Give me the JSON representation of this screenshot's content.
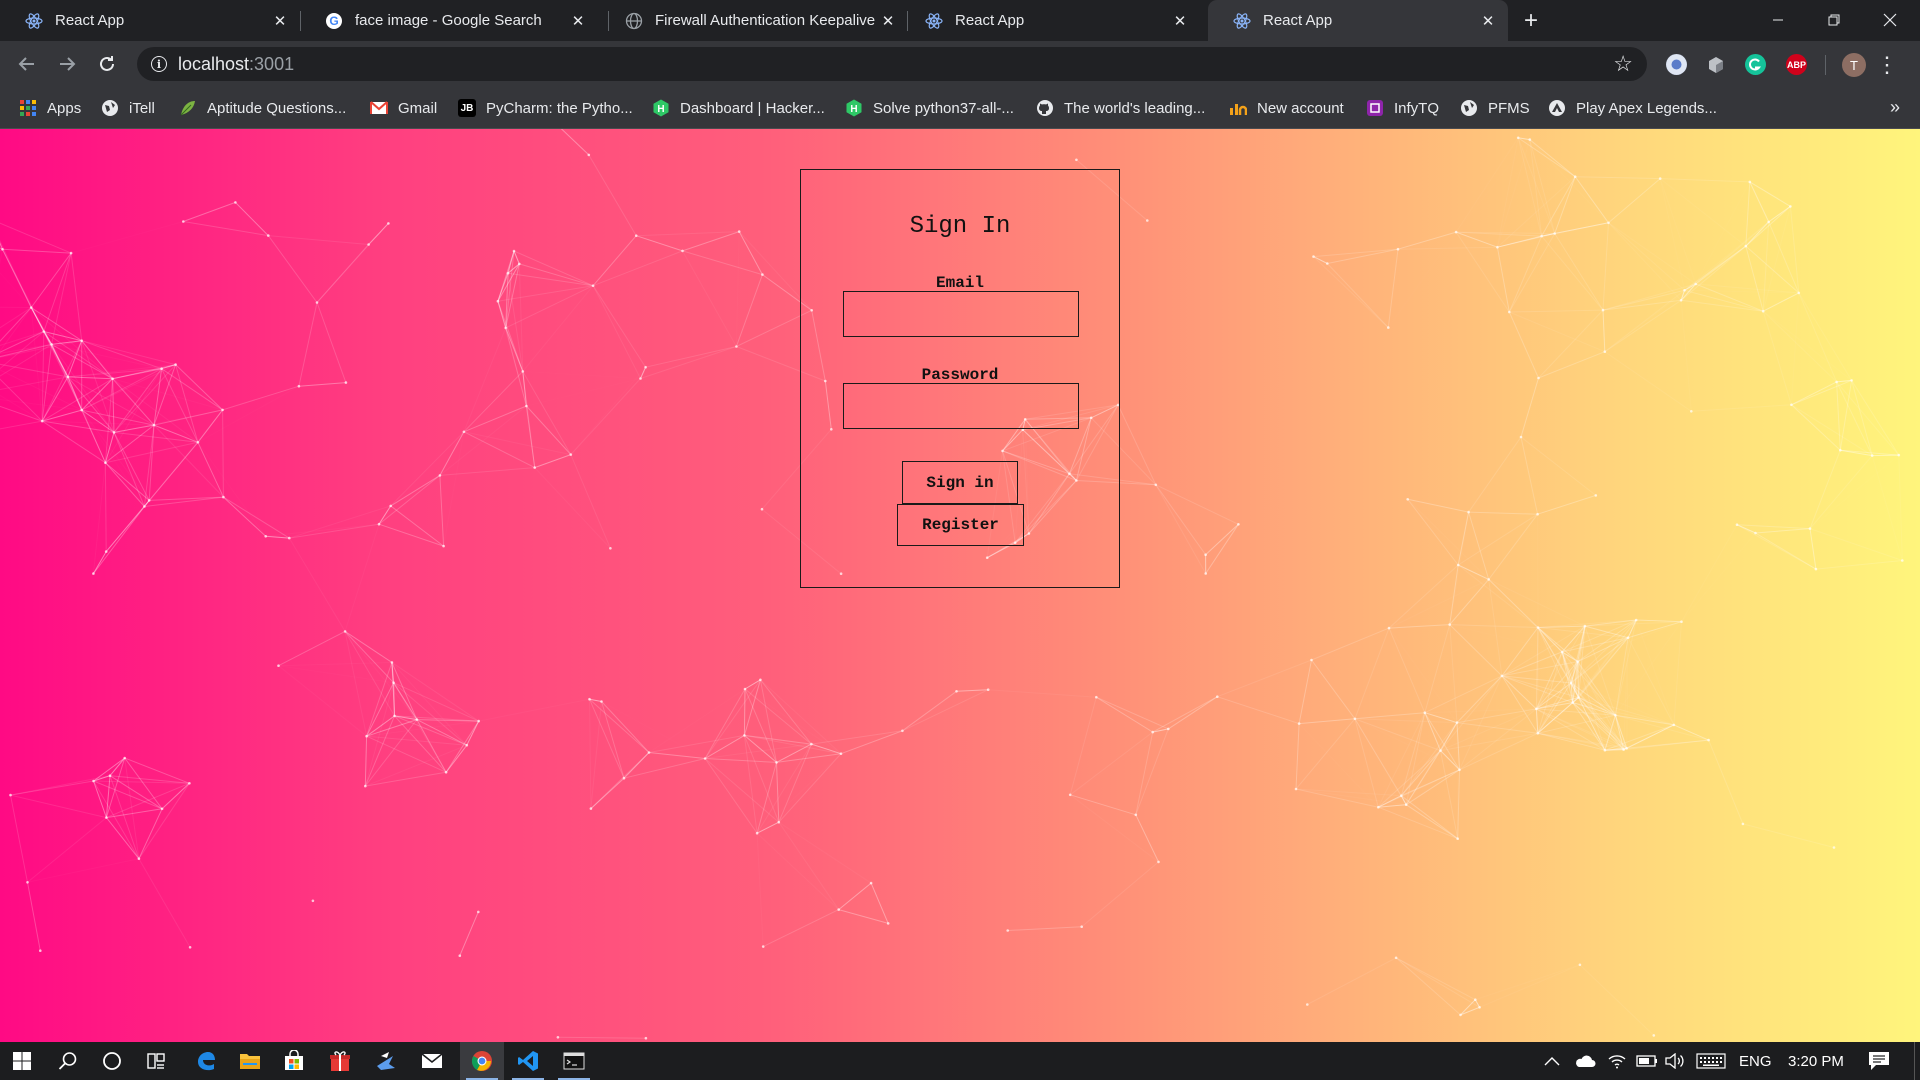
{
  "tabs": [
    {
      "title": "React App",
      "icon": "react-icon",
      "active": false
    },
    {
      "title": "face image - Google Search",
      "icon": "google-icon",
      "active": false
    },
    {
      "title": "Firewall Authentication Keepalive",
      "icon": "globe-icon",
      "active": false
    },
    {
      "title": "React App",
      "icon": "react-icon",
      "active": false
    },
    {
      "title": "React App",
      "icon": "react-icon",
      "active": true
    }
  ],
  "address_bar": {
    "host": "localhost",
    "port": ":3001"
  },
  "bookmarks": [
    {
      "label": "Apps",
      "icon": "apps-grid-icon"
    },
    {
      "label": "iTell",
      "icon": "globe-icon"
    },
    {
      "label": "Aptitude Questions...",
      "icon": "leaf-icon"
    },
    {
      "label": "Gmail",
      "icon": "gmail-icon"
    },
    {
      "label": "PyCharm: the Pytho...",
      "icon": "jetbrains-icon"
    },
    {
      "label": "Dashboard | Hacker...",
      "icon": "hackerrank-icon"
    },
    {
      "label": "Solve python37-all-...",
      "icon": "hackerrank-icon"
    },
    {
      "label": "The world's leading...",
      "icon": "github-icon"
    },
    {
      "label": "New account",
      "icon": "account-icon"
    },
    {
      "label": "InfyTQ",
      "icon": "infytq-icon"
    },
    {
      "label": "PFMS",
      "icon": "globe-icon"
    },
    {
      "label": "Play Apex Legends...",
      "icon": "apex-icon"
    }
  ],
  "profile_initial": "T",
  "extensions": {
    "adblock_label": "ABP"
  },
  "signin": {
    "title": "Sign In",
    "email_label": "Email",
    "password_label": "Password",
    "email_value": "",
    "password_value": "",
    "signin_button": "Sign in",
    "register_button": "Register"
  },
  "taskbar": {
    "language": "ENG",
    "time": "3:20 PM"
  },
  "colors": {
    "gradient_left": "#ff0a84",
    "gradient_right": "#fff57c",
    "chrome_dark": "#202124",
    "chrome_toolbar": "#35363a"
  }
}
